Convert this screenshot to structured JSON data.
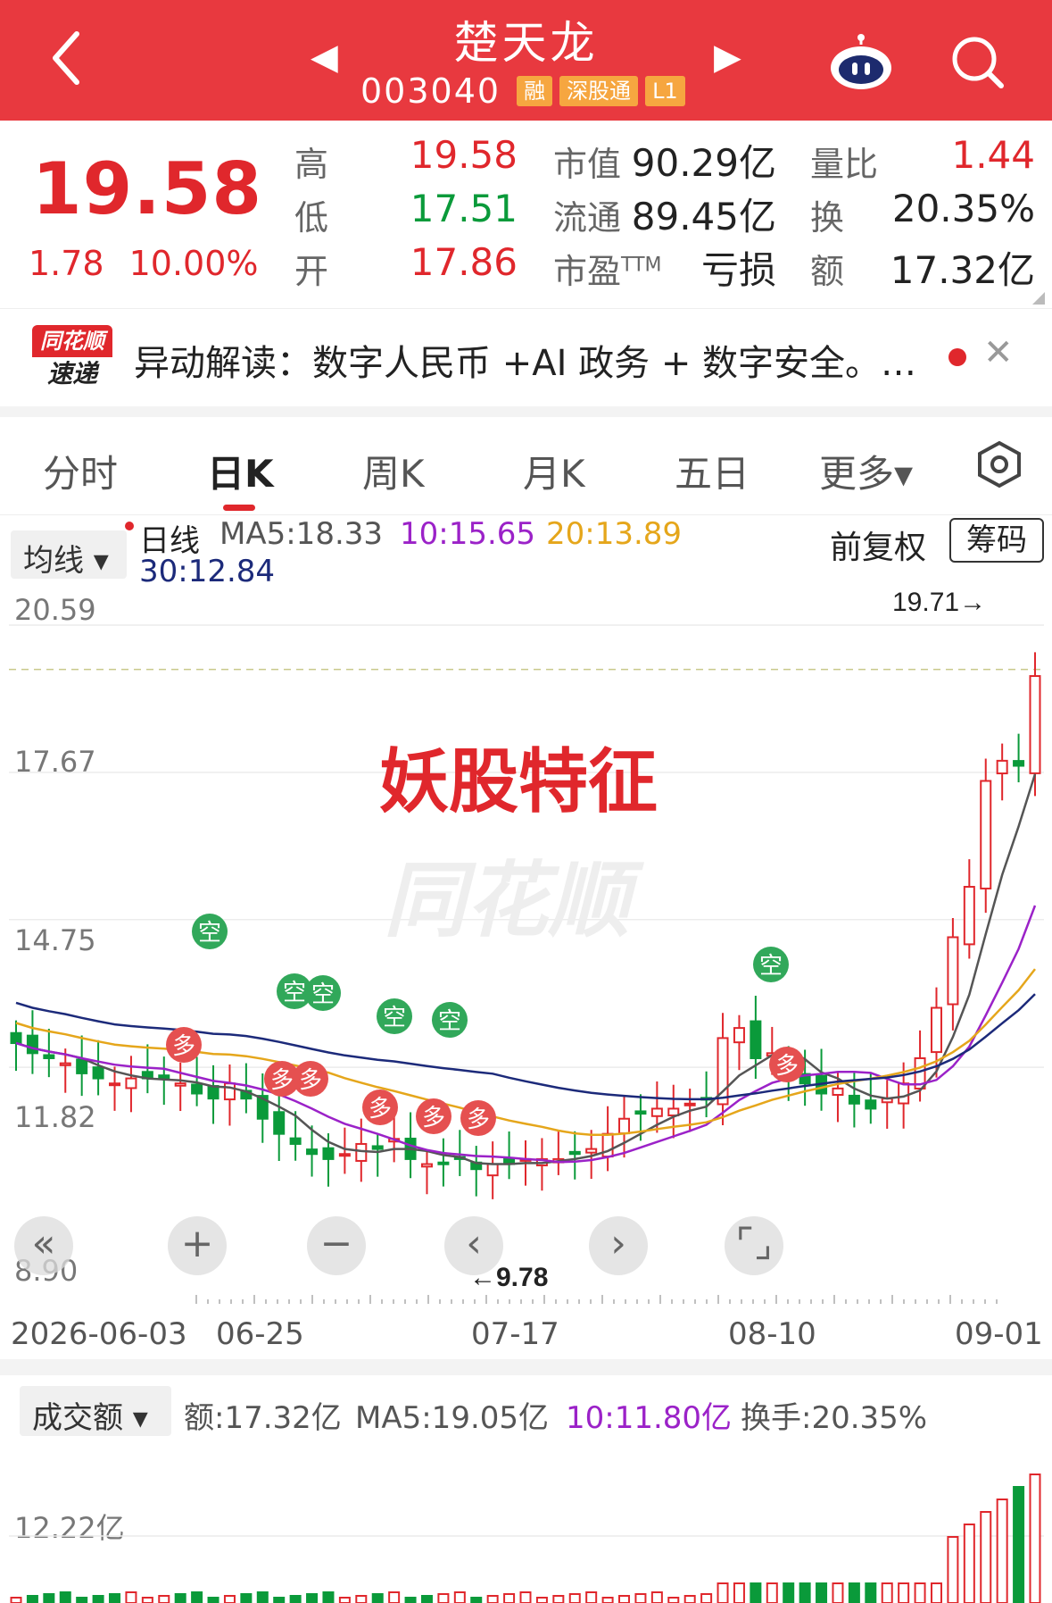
{
  "header": {
    "stock_name": "楚天龙",
    "stock_code": "003040",
    "tags": [
      "融",
      "深股通",
      "L1"
    ],
    "prev_arrow": "◀",
    "next_arrow": "▶"
  },
  "quote": {
    "price": "19.58",
    "change": "1.78",
    "change_pct": "10.00%",
    "high_label": "高",
    "high": "19.58",
    "low_label": "低",
    "low": "17.51",
    "open_label": "开",
    "open": "17.86",
    "mcap_label": "市值",
    "mcap": "90.29亿",
    "float_label": "流通",
    "float_cap": "89.45亿",
    "pe_label": "市盈",
    "pe_sup": "TTM",
    "pe": "亏损",
    "vol_ratio_label": "量比",
    "vol_ratio": "1.44",
    "turnover_label": "换",
    "turnover": "20.35%",
    "amount_label": "额",
    "amount": "17.32亿"
  },
  "news": {
    "logo_top": "同花顺",
    "logo_bottom": "速递",
    "text": "异动解读：数字人民币 +AI 政务 + 数字安全。…"
  },
  "tabs": [
    "分时",
    "日K",
    "周K",
    "月K",
    "五日",
    "更多▾"
  ],
  "indicator": {
    "select": "均线 ▾",
    "period": "日线",
    "ma5": "MA5:18.33",
    "ma10": "10:15.65",
    "ma20": "20:13.89",
    "ma30": "30:12.84",
    "adjust": "前复权",
    "chip_button": "筹码"
  },
  "chart": {
    "y_ticks": [
      "20.59",
      "17.67",
      "14.75",
      "11.82",
      "8.90"
    ],
    "x_ticks": [
      "2026-06-03",
      "06-25",
      "07-17",
      "08-10",
      "09-01"
    ],
    "high_marker": "19.71→",
    "low_marker": "←9.78",
    "overlay_title": "妖股特征",
    "watermark": "同花顺",
    "bubbles_sell": [
      "空",
      "空",
      "空",
      "空",
      "空",
      "空"
    ],
    "bubbles_buy": [
      "多",
      "多",
      "多",
      "多",
      "多",
      "多"
    ],
    "colors": {
      "up": "#e0272c",
      "down": "#0a9a3a",
      "ma5": "#555555",
      "ma10": "#9b22c8",
      "ma20": "#e5a61b",
      "ma30": "#1c2a7a"
    }
  },
  "chart_data": {
    "type": "candlestick",
    "x_range": [
      "2026-06-03",
      "09-01"
    ],
    "ylim": [
      8.9,
      20.59
    ],
    "close_approx": [
      12.3,
      12.1,
      12.0,
      11.9,
      11.7,
      11.6,
      11.5,
      11.6,
      11.6,
      11.6,
      11.5,
      11.3,
      11.2,
      11.5,
      11.2,
      10.8,
      10.5,
      10.3,
      10.1,
      10.0,
      10.1,
      10.3,
      10.2,
      10.4,
      10.0,
      9.9,
      9.9,
      10.0,
      9.8,
      9.9,
      9.9,
      10.0,
      10.0,
      10.0,
      10.1,
      10.2,
      10.5,
      10.8,
      10.9,
      11.0,
      11.0,
      11.1,
      11.2,
      12.4,
      12.6,
      12.0,
      12.1,
      11.7,
      11.5,
      11.3,
      11.4,
      11.1,
      11.0,
      11.2,
      11.5,
      12.0,
      13.0,
      14.4,
      15.4,
      17.5,
      17.9,
      17.8,
      19.58
    ],
    "marker_high": 19.71,
    "marker_low": 9.78,
    "last_ma": {
      "ma5": 18.33,
      "ma10": 15.65,
      "ma20": 13.89,
      "ma30": 12.84
    }
  },
  "volume": {
    "select": "成交额 ▾",
    "amount": "额:17.32亿",
    "ma5": "MA5:19.05亿",
    "ma10": "10:11.80亿",
    "turnover": "换手:20.35%",
    "y_tick": "12.22亿"
  }
}
